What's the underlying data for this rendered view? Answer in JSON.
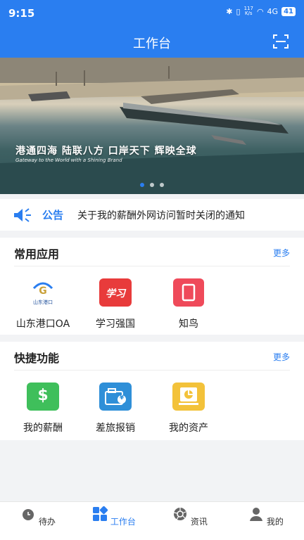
{
  "status": {
    "time": "9:15",
    "net_top": "117",
    "net_bottom": "K/s",
    "signal": "4G",
    "battery": "41"
  },
  "header": {
    "title": "工作台"
  },
  "banner": {
    "slogan": "港通四海 陆联八方 口岸天下 辉映全球",
    "subtitle": "Gateway to the World with a Shining Brand"
  },
  "notice": {
    "title": "公告",
    "text": "关于我的薪酬外网访问暂时关闭的通知"
  },
  "common_apps": {
    "title": "常用应用",
    "more": "更多",
    "items": [
      {
        "label": "山东港口OA",
        "logo_text": "山东港口"
      },
      {
        "label": "学习强国",
        "logo_text": "学习"
      },
      {
        "label": "知鸟"
      }
    ]
  },
  "quick_functions": {
    "title": "快捷功能",
    "more": "更多",
    "items": [
      {
        "label": "我的薪酬",
        "icon_text": "$"
      },
      {
        "label": "差旅报销",
        "icon_text": "¥"
      },
      {
        "label": "我的资产"
      }
    ]
  },
  "tabbar": {
    "items": [
      {
        "label": "待办",
        "active": false
      },
      {
        "label": "工作台",
        "active": true
      },
      {
        "label": "资讯",
        "active": false
      },
      {
        "label": "我的",
        "active": false
      }
    ]
  },
  "colors": {
    "primary": "#2a7ef0",
    "green": "#3fbf5b",
    "blue": "#2f8fd8",
    "yellow": "#f3c23a",
    "red": "#e83b3b",
    "pink": "#ef4a5a"
  }
}
